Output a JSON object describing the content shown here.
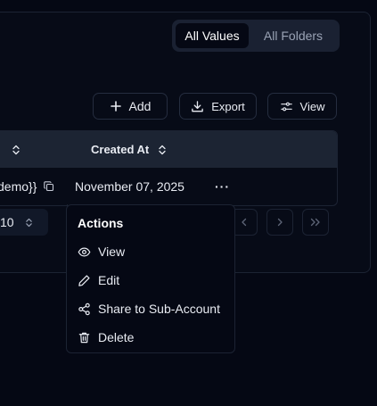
{
  "toggle": {
    "active": "All Values",
    "inactive": "All Folders"
  },
  "toolbar": {
    "add_label": "Add",
    "export_label": "Export",
    "view_label": "View"
  },
  "table": {
    "columns": [
      "",
      "Created At"
    ],
    "row": {
      "name_fragment": "demo}}",
      "created_at": "November 07, 2025",
      "actions": "···"
    }
  },
  "pagination": {
    "rows_per_page": "10"
  },
  "menu": {
    "title": "Actions",
    "items": [
      {
        "label": "View",
        "icon": "eye-icon"
      },
      {
        "label": "Edit",
        "icon": "pencil-icon"
      },
      {
        "label": "Share to Sub-Account",
        "icon": "share-icon"
      },
      {
        "label": "Delete",
        "icon": "trash-icon"
      }
    ]
  },
  "colors": {
    "background": "#050814",
    "header": "#1c2433",
    "border": "#1c2333",
    "text": "#e8ebf2",
    "muted": "#9aa3b5"
  }
}
